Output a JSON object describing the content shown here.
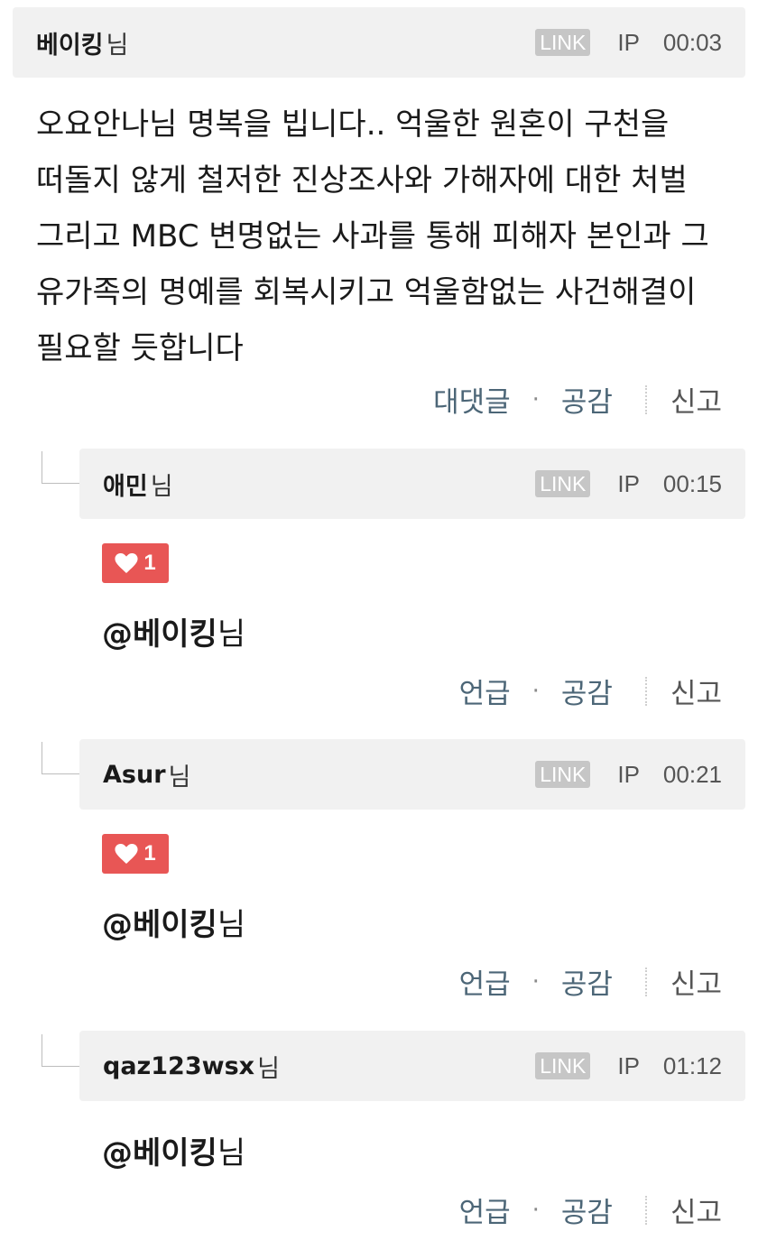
{
  "main_comment": {
    "author": "베이킹",
    "suffix": "님",
    "link": "LINK",
    "ip": "IP",
    "time": "00:03",
    "text": "오요안나님 명복을 빕니다.. 억울한 원혼이 구천을 떠돌지 않게 철저한 진상조사와 가해자에 대한 처벌 그리고 MBC 변명없는 사과를 통해 피해자 본인과 그 유가족의 명예를 회복시키고 억울함없는 사건해결이 필요할 듯합니다",
    "actions": {
      "reply": "대댓글",
      "like": "공감",
      "report": "신고"
    }
  },
  "replies": [
    {
      "author": "애민",
      "suffix": "님",
      "link": "LINK",
      "ip": "IP",
      "time": "00:15",
      "likes": "1",
      "mention_at": "@베이킹",
      "mention_suffix": "님",
      "actions": {
        "mention": "언급",
        "like": "공감",
        "report": "신고"
      }
    },
    {
      "author": "Asur",
      "suffix": "님",
      "link": "LINK",
      "ip": "IP",
      "time": "00:21",
      "likes": "1",
      "mention_at": "@베이킹",
      "mention_suffix": "님",
      "actions": {
        "mention": "언급",
        "like": "공감",
        "report": "신고"
      }
    },
    {
      "author": "qaz123wsx",
      "suffix": "님",
      "link": "LINK",
      "ip": "IP",
      "time": "01:12",
      "mention_at": "@베이킹",
      "mention_suffix": "님",
      "actions": {
        "mention": "언급",
        "like": "공감",
        "report": "신고"
      }
    }
  ],
  "icons": {
    "like": "heart-icon"
  },
  "colors": {
    "like_badge": "#e85655",
    "action_link": "#4c6677",
    "header_bg": "#f1f1f1"
  }
}
